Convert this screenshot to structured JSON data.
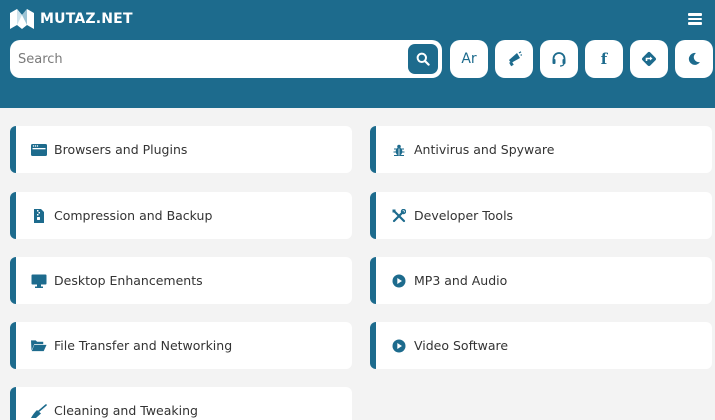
{
  "brand": {
    "name": "MUTAZ.NET"
  },
  "search": {
    "placeholder": "Search"
  },
  "header_buttons": {
    "language_label": "Ar",
    "facebook_label": "f"
  },
  "categories": [
    {
      "label": "Browsers and Plugins",
      "icon": "browser-icon"
    },
    {
      "label": "Antivirus and Spyware",
      "icon": "bug-icon"
    },
    {
      "label": "Compression and Backup",
      "icon": "file-zipper-icon"
    },
    {
      "label": "Developer Tools",
      "icon": "tools-icon"
    },
    {
      "label": "Desktop Enhancements",
      "icon": "desktop-icon"
    },
    {
      "label": "MP3 and Audio",
      "icon": "play-circle-icon"
    },
    {
      "label": "File Transfer and Networking",
      "icon": "folder-open-icon"
    },
    {
      "label": "Video Software",
      "icon": "play-circle-icon"
    },
    {
      "label": "Cleaning and Tweaking",
      "icon": "broom-icon"
    }
  ],
  "colors": {
    "primary": "#1d6b8d",
    "background": "#f3f3f3",
    "card": "#ffffff"
  }
}
